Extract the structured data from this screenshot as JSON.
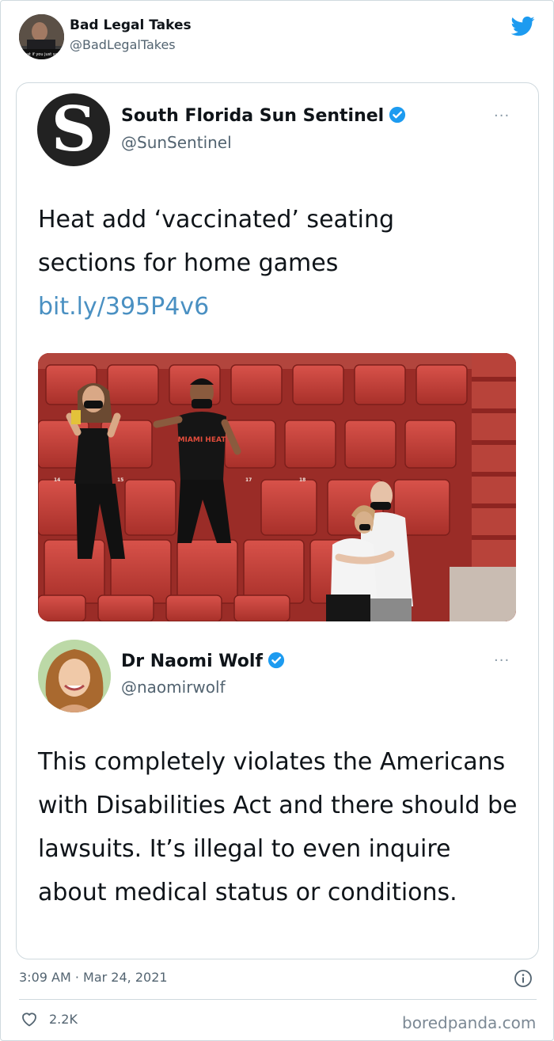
{
  "outer_tweet": {
    "author_name": "Bad Legal Takes",
    "author_handle": "@BadLegalTakes",
    "avatar_caption": "What if you just say?",
    "timestamp": "3:09 AM · Mar 24, 2021",
    "likes": "2.2K"
  },
  "quoted_tweet": {
    "author_name": "South Florida Sun Sentinel",
    "author_handle": "@SunSentinel",
    "avatar_letter": "S",
    "text": "Heat add ‘vaccinated’ seating sections for home games ",
    "link": "bit.ly/395P4v6",
    "more_label": "···",
    "photo_jersey_text": "MIAMI HEAT",
    "photo_seat_numbers": [
      "14",
      "15",
      "17",
      "18"
    ]
  },
  "reply_tweet": {
    "author_name": "Dr Naomi Wolf",
    "author_handle": "@naomirwolf",
    "text": "This completely violates the Americans with Disabilities Act and there should be lawsuits. It’s illegal to even inquire about medical status or conditions.",
    "more_label": "···"
  },
  "watermark": "boredpanda.com",
  "colors": {
    "twitter_blue": "#1d9bf0",
    "link": "#4a90c2",
    "verified": "#1d9bf0",
    "seat_red": "#c8403a"
  }
}
